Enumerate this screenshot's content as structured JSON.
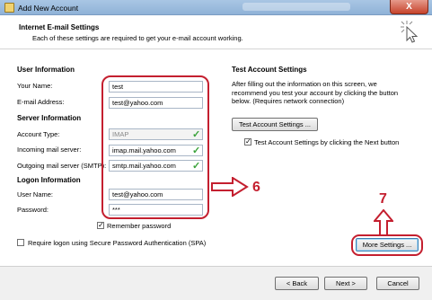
{
  "window": {
    "title": "Add New Account",
    "close_label": "X"
  },
  "header": {
    "title": "Internet E-mail Settings",
    "subtitle": "Each of these settings are required to get your e-mail account working."
  },
  "user_info": {
    "heading": "User Information",
    "name_label": "Your Name:",
    "name_value": "test",
    "email_label": "E-mail Address:",
    "email_value": "test@yahoo.com"
  },
  "server_info": {
    "heading": "Server Information",
    "account_type_label": "Account Type:",
    "account_type_value": "IMAP",
    "incoming_label": "Incoming mail server:",
    "incoming_value": "imap.mail.yahoo.com",
    "outgoing_label": "Outgoing mail server (SMTP):",
    "outgoing_value": "smtp.mail.yahoo.com"
  },
  "logon_info": {
    "heading": "Logon Information",
    "username_label": "User Name:",
    "username_value": "test@yahoo.com",
    "password_label": "Password:",
    "password_value": "***",
    "remember_label": "Remember password",
    "remember_checked": true,
    "spa_label": "Require logon using Secure Password Authentication (SPA)",
    "spa_checked": false
  },
  "test_settings": {
    "heading": "Test Account Settings",
    "description": "After filling out the information on this screen, we recommend you test your account by clicking the button below. (Requires network connection)",
    "test_button": "Test Account Settings ...",
    "test_next_label": "Test Account Settings by clicking the Next button",
    "test_next_checked": true
  },
  "more_settings_button": "More Settings ...",
  "annotations": {
    "step6": "6",
    "step7": "7"
  },
  "footer": {
    "back": "< Back",
    "next": "Next >",
    "cancel": "Cancel"
  },
  "colors": {
    "annotation_red": "#c41f2f",
    "check_green": "#3aa23a",
    "title_bar": "#9fbfe0"
  }
}
